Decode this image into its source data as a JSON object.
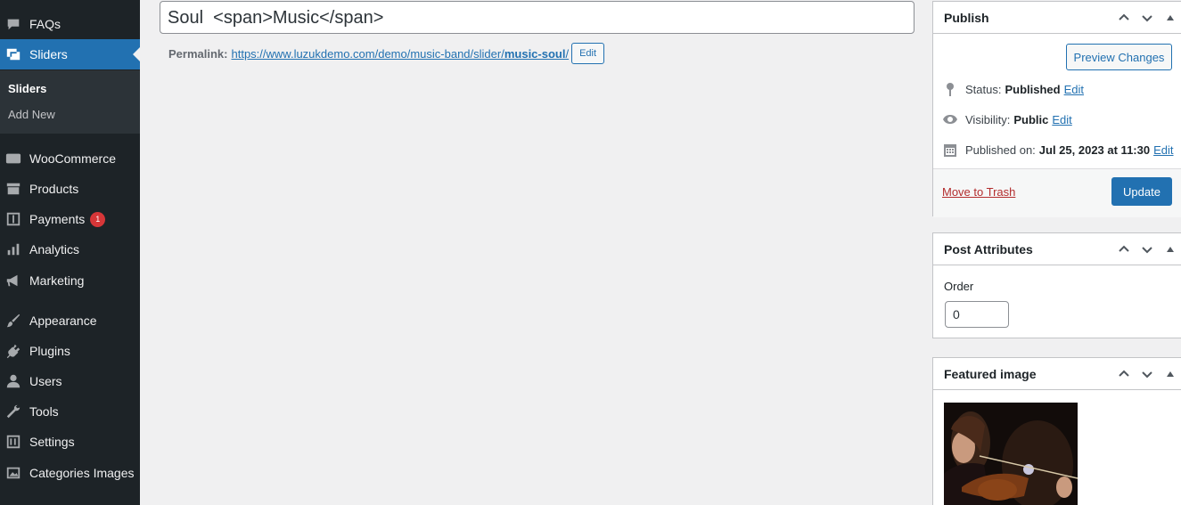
{
  "sidebar": {
    "items": [
      {
        "label": "FAQs",
        "icon": "speech-bubble-icon"
      },
      {
        "label": "Sliders",
        "icon": "images-icon",
        "current": true
      },
      {
        "label": "WooCommerce",
        "icon": "woocommerce-icon"
      },
      {
        "label": "Products",
        "icon": "archive-box-icon"
      },
      {
        "label": "Payments",
        "icon": "dollar-card-icon",
        "badge": "1"
      },
      {
        "label": "Analytics",
        "icon": "bar-chart-icon"
      },
      {
        "label": "Marketing",
        "icon": "megaphone-icon"
      },
      {
        "label": "Appearance",
        "icon": "paintbrush-icon"
      },
      {
        "label": "Plugins",
        "icon": "plug-icon"
      },
      {
        "label": "Users",
        "icon": "user-icon"
      },
      {
        "label": "Tools",
        "icon": "wrench-icon"
      },
      {
        "label": "Settings",
        "icon": "sliders-settings-icon"
      },
      {
        "label": "Categories Images",
        "icon": "image-icon"
      }
    ],
    "submenu": [
      {
        "label": "Sliders",
        "active": true
      },
      {
        "label": "Add New"
      }
    ]
  },
  "editor": {
    "title_value": "Soul  <span>Music</span>",
    "permalink_label": "Permalink:",
    "permalink_base": "https://www.luzukdemo.com/demo/music-band/slider/",
    "permalink_slug": "music-soul",
    "permalink_trailing": "/",
    "permalink_edit": "Edit"
  },
  "publish": {
    "title": "Publish",
    "preview_button": "Preview Changes",
    "status_label": "Status:",
    "status_value": "Published",
    "visibility_label": "Visibility:",
    "visibility_value": "Public",
    "published_label": "Published on:",
    "published_value": "Jul 25, 2023 at 11:30",
    "edit_link": "Edit",
    "trash_link": "Move to Trash",
    "update_button": "Update"
  },
  "post_attributes": {
    "title": "Post Attributes",
    "order_label": "Order",
    "order_value": "0"
  },
  "featured_image": {
    "title": "Featured image"
  },
  "colors": {
    "sidebar_bg": "#1d2327",
    "accent": "#2271b1",
    "badge": "#d63638",
    "trash": "#b32d2e"
  }
}
